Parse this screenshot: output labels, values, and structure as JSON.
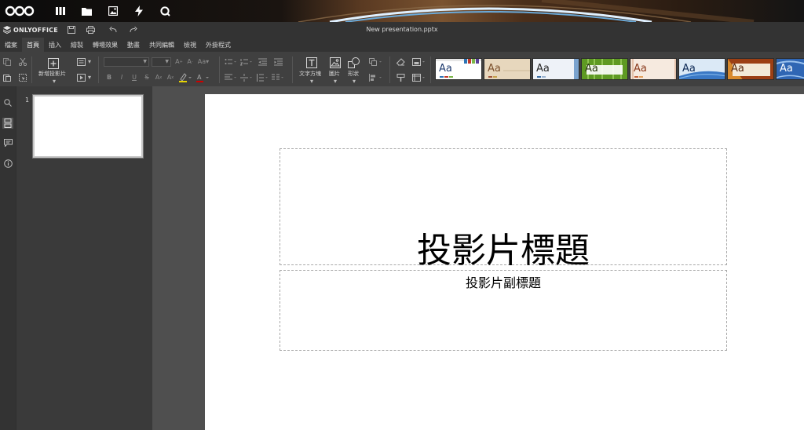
{
  "nextcloud": {
    "icons": [
      "nextcloud-logo-icon",
      "dashboard-icon",
      "files-icon",
      "photos-icon",
      "activity-icon",
      "search-icon"
    ]
  },
  "header": {
    "logo_text": "ONLYOFFICE",
    "document_title": "New presentation.pptx",
    "quick_actions": [
      "save-icon",
      "print-icon",
      "undo-icon",
      "redo-icon"
    ]
  },
  "tabs": [
    {
      "label": "檔案",
      "active": false
    },
    {
      "label": "首頁",
      "active": true
    },
    {
      "label": "插入",
      "active": false
    },
    {
      "label": "繪製",
      "active": false
    },
    {
      "label": "轉場效果",
      "active": false
    },
    {
      "label": "動畫",
      "active": false
    },
    {
      "label": "共同編輯",
      "active": false
    },
    {
      "label": "檢視",
      "active": false
    },
    {
      "label": "外掛程式",
      "active": false
    }
  ],
  "toolbar": {
    "new_slide_label": "新增投影片",
    "text_box_label": "文字方塊",
    "image_label": "圖片",
    "shape_label": "形狀",
    "font_name": "",
    "font_size": "",
    "themes": [
      {
        "name": "theme-blank",
        "label": "Aa"
      },
      {
        "name": "theme-classic",
        "label": "Aa"
      },
      {
        "name": "theme-official",
        "label": "Aa"
      },
      {
        "name": "theme-green-leaf",
        "label": "Aa"
      },
      {
        "name": "theme-lines",
        "label": "Aa"
      },
      {
        "name": "theme-office",
        "label": "Aa"
      },
      {
        "name": "theme-safari",
        "label": "Aa"
      },
      {
        "name": "theme-blue",
        "label": "Aa"
      }
    ]
  },
  "thumbnails": [
    {
      "number": "1"
    }
  ],
  "slide": {
    "title": "投影片標題",
    "subtitle": "投影片副標題"
  },
  "colors": {
    "nc_bar": "#0b0b0b",
    "app_bg": "#333333",
    "toolbar_bg": "#404040",
    "work_bg": "#4f4f4f",
    "active_tab": "#404040"
  }
}
